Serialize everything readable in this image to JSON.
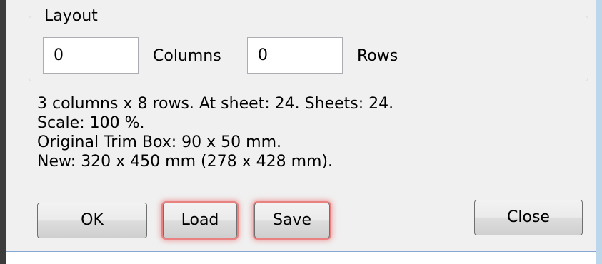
{
  "layout_group": {
    "title": "Layout",
    "columns_value": "0",
    "columns_label": "Columns",
    "rows_value": "0",
    "rows_label": "Rows"
  },
  "info_lines": [
    "3 columns x 8 rows. At sheet: 24. Sheets: 24.",
    "Scale: 100 %.",
    "Original Trim Box: 90 x 50 mm.",
    "New: 320 x 450 mm (278 x 428 mm)."
  ],
  "buttons": {
    "ok": "OK",
    "load": "Load",
    "save": "Save",
    "close": "Close"
  },
  "colors": {
    "panel": "#f0f0f0",
    "highlight_glow": "#e65a5a",
    "window_border": "#bcd6ec"
  }
}
